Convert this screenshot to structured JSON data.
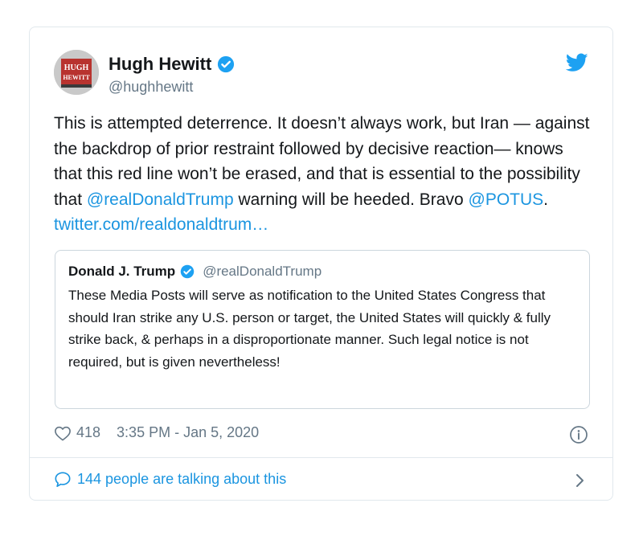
{
  "tweet": {
    "author": {
      "display_name": "Hugh Hewitt",
      "handle": "@hughhewitt",
      "verified": true,
      "avatar_text_line1": "HUGH",
      "avatar_text_line2": "HEWITT"
    },
    "text": {
      "part1": "This is attempted deterrence. It doesn’t always work, but Iran — against the backdrop of prior restraint followed by decisive reaction— knows that this red line won’t be erased, and that is essential to the possibility that ",
      "mention1": "@realDonaldTrump",
      "part2": " warning will be heeded. Bravo ",
      "mention2": "@POTUS",
      "part3": ". ",
      "link": "twitter.com/realdonaldtrum…"
    },
    "quoted": {
      "display_name": "Donald J. Trump",
      "handle": "@realDonaldTrump",
      "verified": true,
      "text": "These Media Posts will serve as notification to the United States Congress that should Iran strike any U.S. person or target, the United States will quickly & fully strike back, & perhaps in a disproportionate manner. Such legal notice is not required, but is given nevertheless!"
    },
    "likes": "418",
    "timestamp": "3:35 PM - Jan 5, 2020",
    "conversation_label": "144 people are talking about this"
  },
  "icons": {
    "platform": "twitter-bird-icon",
    "verified": "verified-badge-icon",
    "like": "heart-icon",
    "info": "info-icon",
    "reply": "speech-bubble-icon",
    "chevron": "chevron-right-icon"
  },
  "colors": {
    "accent": "#1b95e0",
    "verified": "#1da1f2",
    "text": "#14171a",
    "secondary": "#657786",
    "border": "#e1e8ed"
  }
}
